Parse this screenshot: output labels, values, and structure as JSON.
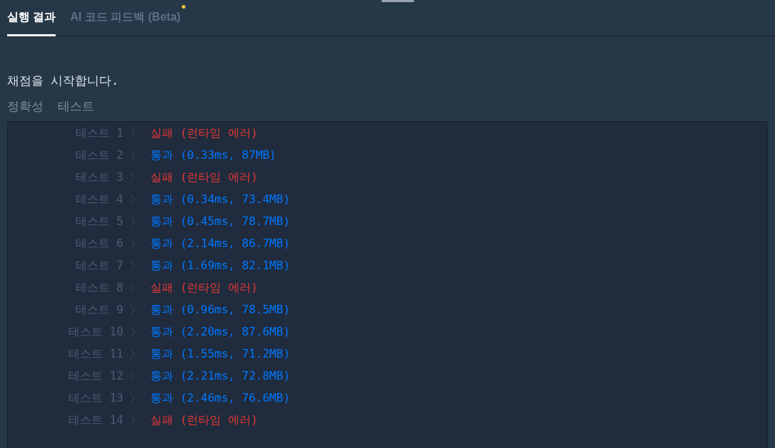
{
  "tabs": [
    {
      "label": "실행 결과",
      "selected": true,
      "badge_dot": false
    },
    {
      "label": "AI 코드 피드백 (Beta)",
      "selected": false,
      "badge_dot": true
    }
  ],
  "message": "채점을 시작합니다.",
  "section_title": "정확성  테스트",
  "results": [
    {
      "label": "테스트 1",
      "kind": "fail",
      "result": "실패 (런타임 에러)"
    },
    {
      "label": "테스트 2",
      "kind": "pass",
      "result": "통과 (0.33ms, 87MB)"
    },
    {
      "label": "테스트 3",
      "kind": "fail",
      "result": "실패 (런타임 에러)"
    },
    {
      "label": "테스트 4",
      "kind": "pass",
      "result": "통과 (0.34ms, 73.4MB)"
    },
    {
      "label": "테스트 5",
      "kind": "pass",
      "result": "통과 (0.45ms, 78.7MB)"
    },
    {
      "label": "테스트 6",
      "kind": "pass",
      "result": "통과 (2.14ms, 86.7MB)"
    },
    {
      "label": "테스트 7",
      "kind": "pass",
      "result": "통과 (1.69ms, 82.1MB)"
    },
    {
      "label": "테스트 8",
      "kind": "fail",
      "result": "실패 (런타임 에러)"
    },
    {
      "label": "테스트 9",
      "kind": "pass",
      "result": "통과 (0.96ms, 78.5MB)"
    },
    {
      "label": "테스트 10",
      "kind": "pass",
      "result": "통과 (2.20ms, 87.6MB)"
    },
    {
      "label": "테스트 11",
      "kind": "pass",
      "result": "통과 (1.55ms, 71.2MB)"
    },
    {
      "label": "테스트 12",
      "kind": "pass",
      "result": "통과 (2.21ms, 72.8MB)"
    },
    {
      "label": "테스트 13",
      "kind": "pass",
      "result": "통과 (2.46ms, 76.6MB)"
    },
    {
      "label": "테스트 14",
      "kind": "fail",
      "result": "실패 (런타임 에러)"
    }
  ]
}
